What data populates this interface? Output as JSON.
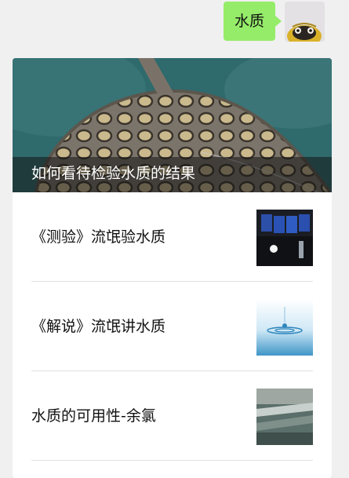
{
  "chat": {
    "bubble_text": "水质"
  },
  "card": {
    "hero_title": "如何看待检验水质的结果",
    "items": [
      {
        "title": "《测验》流氓验水质",
        "thumb_icon": "lab-photo-icon"
      },
      {
        "title": "《解说》流氓讲水质",
        "thumb_icon": "water-drop-photo-icon"
      },
      {
        "title": "水质的可用性-余氯",
        "thumb_icon": "water-tank-photo-icon"
      }
    ]
  },
  "colors": {
    "bubble": "#95ec69",
    "background": "#f0f0f0",
    "card": "#ffffff"
  }
}
